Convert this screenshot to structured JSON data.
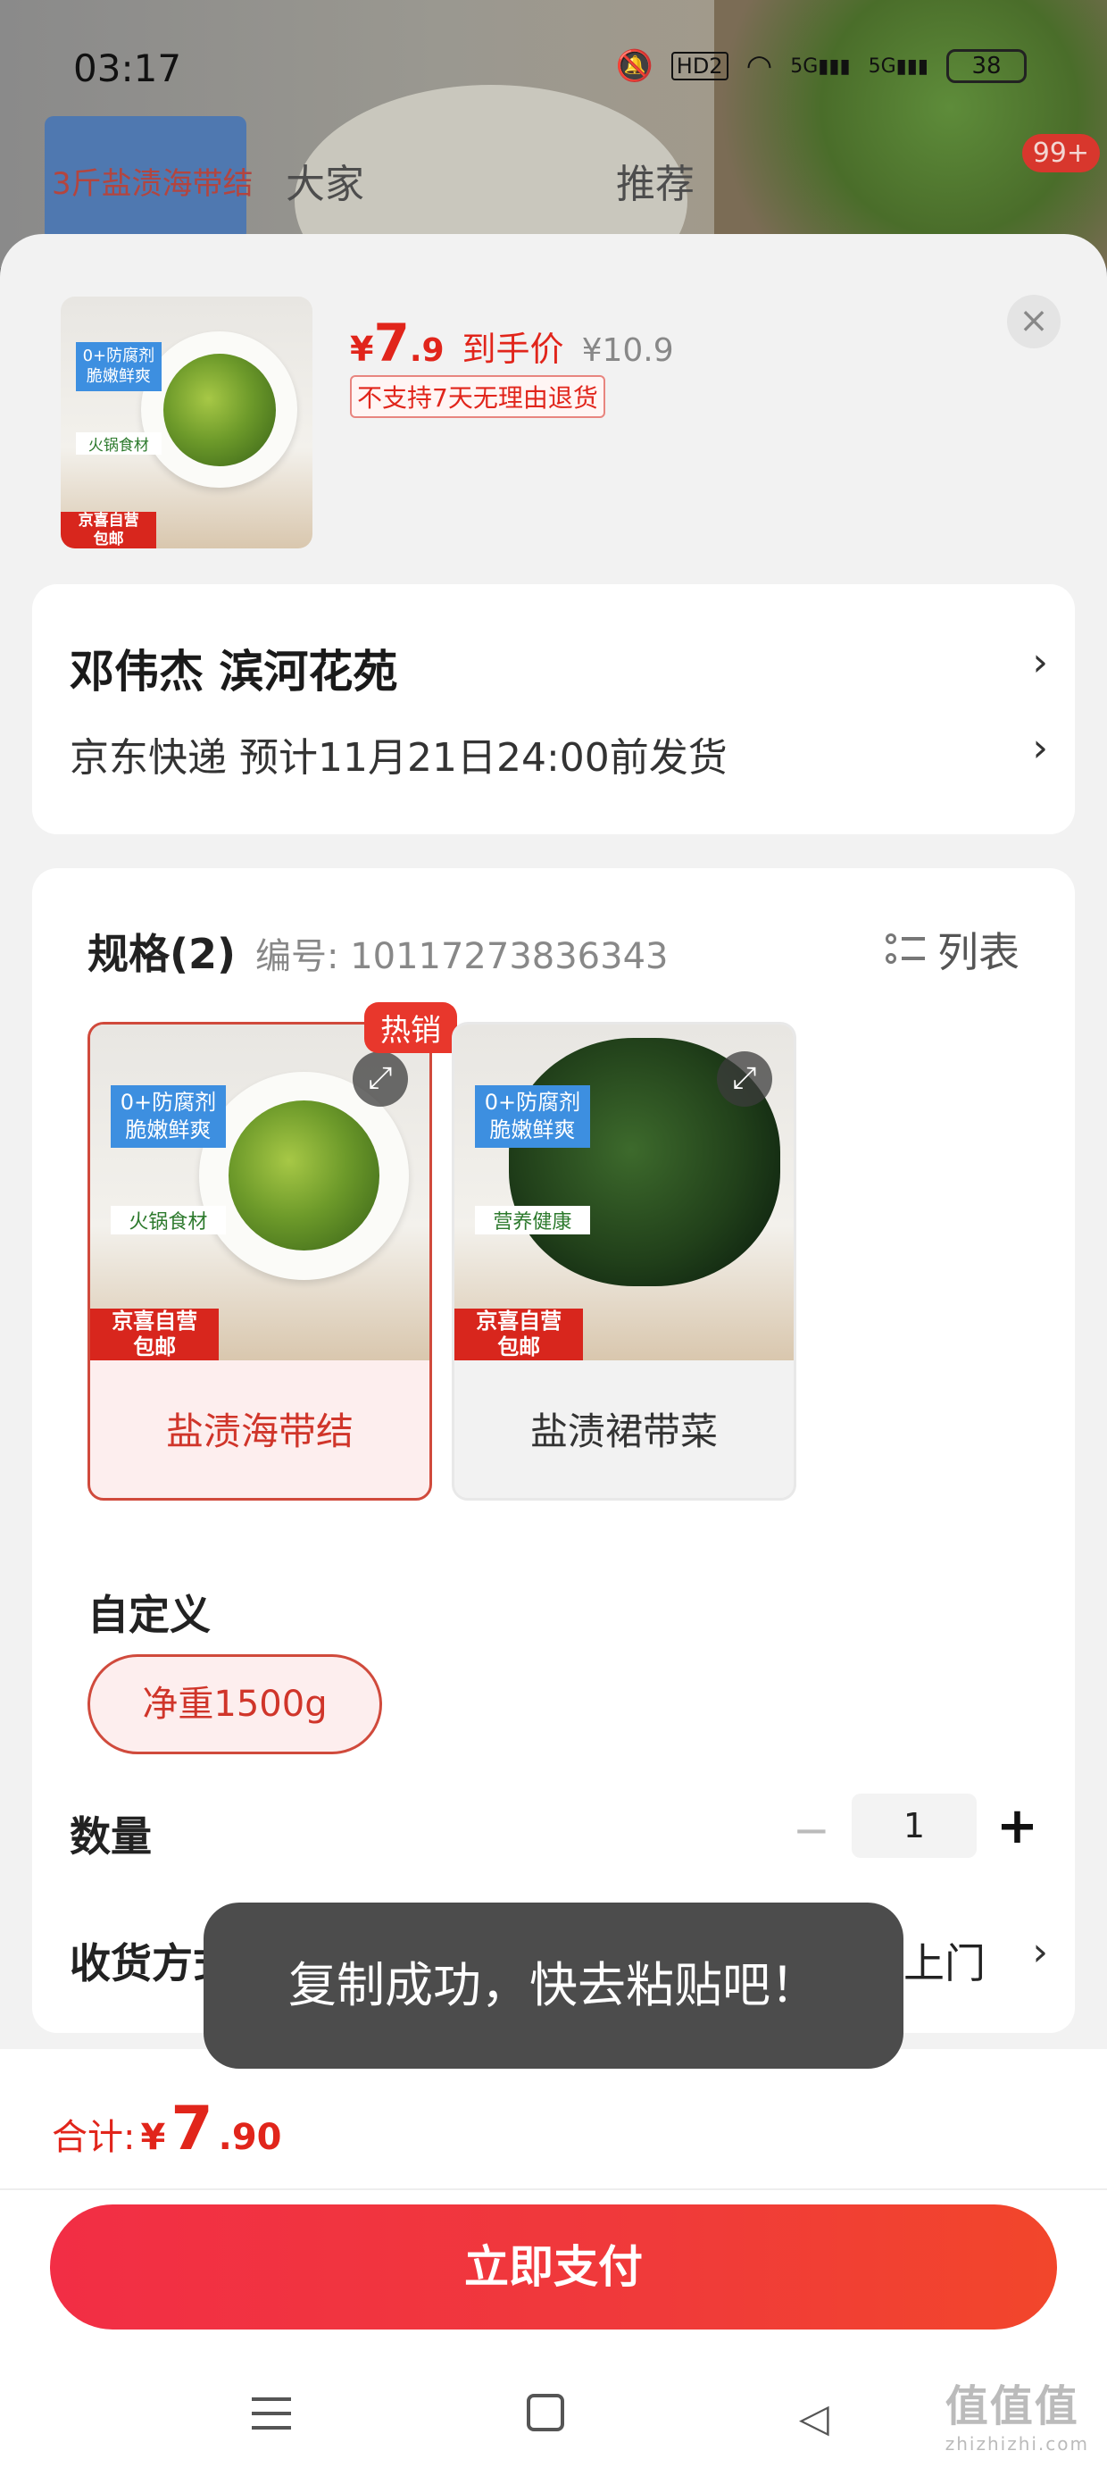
{
  "status_bar": {
    "time": "03:17",
    "battery": "38",
    "hd_label": "HD2",
    "net1": "5G",
    "net2": "5G"
  },
  "background": {
    "tab_left": "3斤盐渍海带结",
    "tab_mid": "大家",
    "tab_right": "推荐",
    "badge": "99+"
  },
  "product": {
    "price_symbol": "¥",
    "price_int": "7",
    "price_dec": ".9",
    "price_label": "到手价",
    "orig_price": "¥10.9",
    "notice": "不支持7天无理由退货",
    "close_icon": "close-icon",
    "thumb": {
      "line1": "0+防腐剂",
      "line2": "脆嫩鲜爽",
      "line3": "火锅食材",
      "badge1": "京喜自营",
      "badge2": "包邮"
    }
  },
  "address": {
    "name_line": "邓伟杰  滨河花苑",
    "shipping": "京东快递 预计11月21日24:00前发货"
  },
  "spec": {
    "title": "规格(2)",
    "code_label": "编号: 10117273836343",
    "list_label": "列表",
    "hot_badge": "热销",
    "options": [
      {
        "label": "盐渍海带结",
        "selected": true,
        "tag1": "0+防腐剂",
        "tag2": "脆嫩鲜爽",
        "tag3": "火锅食材",
        "badge1": "京喜自营",
        "badge2": "包邮"
      },
      {
        "label": "盐渍裙带菜",
        "selected": false,
        "tag1": "0+防腐剂",
        "tag2": "脆嫩鲜爽",
        "tag3": "营养健康",
        "badge1": "京喜自营",
        "badge2": "包邮"
      }
    ],
    "custom_title": "自定义",
    "custom_chip": "净重1500g",
    "qty_title": "数量",
    "qty_minus": "−",
    "qty_value": "1",
    "qty_plus": "+",
    "delivery_title": "收货方式",
    "delivery_value": "送货上门"
  },
  "toast": "复制成功，快去粘贴吧！",
  "footer": {
    "total_label": "合计:",
    "total_symbol": "¥",
    "total_int": "7",
    "total_dec": ".90",
    "pay_label": "立即支付"
  },
  "watermark": {
    "main": "值值值",
    "sub": "zhizhizhi.com"
  },
  "colors": {
    "accent": "#e1251b",
    "pay_start": "#f22e45",
    "pay_end": "#f2462b"
  }
}
